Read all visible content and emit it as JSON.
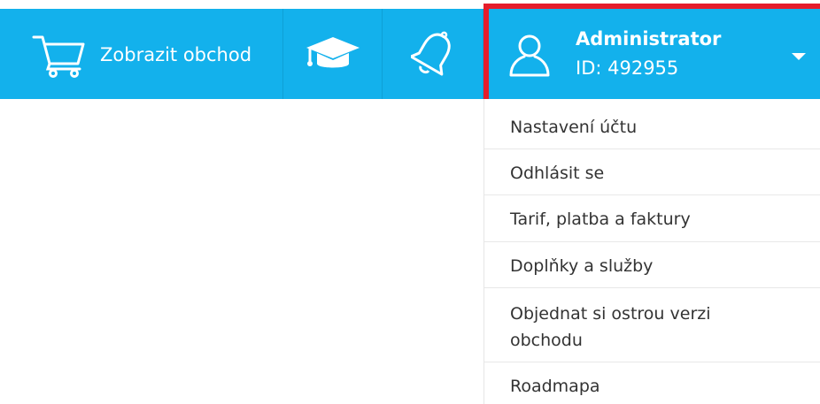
{
  "topbar": {
    "shop_label": "Zobrazit obchod",
    "icons": [
      "cart-icon",
      "graduation-cap-icon",
      "bell-icon",
      "user-icon",
      "caret-down-icon"
    ],
    "background": "#13b1ec"
  },
  "account": {
    "name": "Administrator",
    "id_label": "ID: 492955",
    "highlight_color": "#e51d2b"
  },
  "menu": {
    "items": [
      {
        "label": "Nastavení účtu"
      },
      {
        "label": "Odhlásit se"
      },
      {
        "label": "Tarif, platba a faktury"
      },
      {
        "label": "Doplňky a služby"
      },
      {
        "label": "Objednat si ostrou verzi obchodu"
      },
      {
        "label": "Roadmapa"
      }
    ]
  }
}
